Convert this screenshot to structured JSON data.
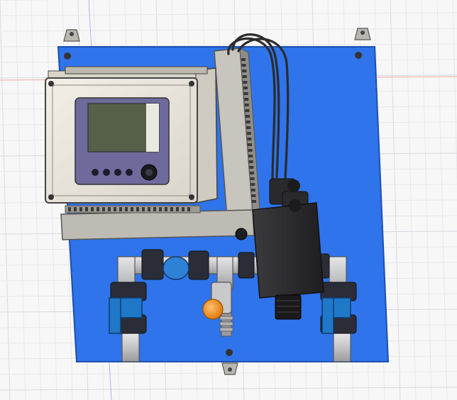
{
  "scene": {
    "kind": "cad-3d-viewport",
    "description_label": "",
    "colors": {
      "background": "#f7f7f7",
      "grid_minor": "#e6e8ec",
      "grid_major": "#d6d9df",
      "axis_red": "#f2a9a9",
      "axis_blue": "#aab2f0",
      "panel_blue": "#2f74ea",
      "panel_edge": "#1d4fb0",
      "controller_body": "#eae7df",
      "controller_frame": "#d8d4c8",
      "screen_bezel": "#6f6a9c",
      "screen_lcd": "#56604a",
      "bracket_gray": "#b9b7b0",
      "pipe_gray": "#c9c9cb",
      "valve_blue": "#1f78c8",
      "sensor_block": "#2c2c2e",
      "orange_knob": "#f39a1f",
      "cable_dark": "#2b2b2b"
    },
    "keypad_buttons": 4,
    "valve_handles": 2
  }
}
